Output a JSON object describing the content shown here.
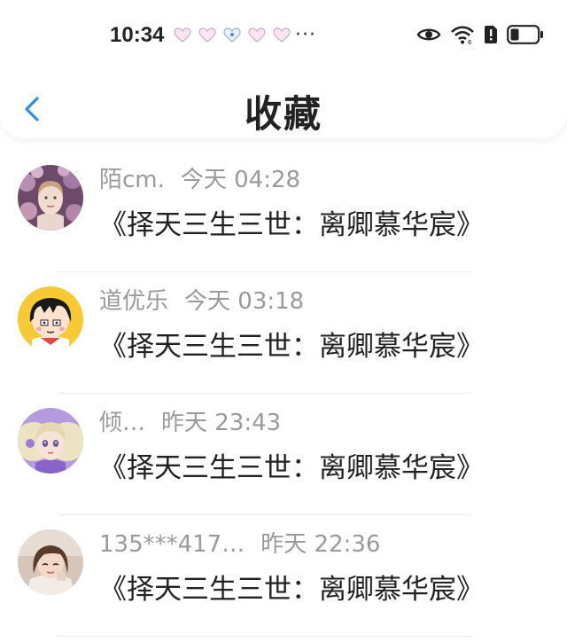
{
  "status_bar": {
    "time": "10:34",
    "more": "···",
    "notification_icons": [
      "heart-icon",
      "heart-icon",
      "heart-icon",
      "heart-icon",
      "heart-icon"
    ],
    "system_icons": [
      "eye-icon",
      "wifi-icon",
      "sim-alert-icon",
      "battery-icon"
    ]
  },
  "header": {
    "title": "收藏",
    "back_icon": "chevron-left-icon",
    "accent": "#2f8ee6"
  },
  "favorites": [
    {
      "name": "陌cm.",
      "time": "今天 04:28",
      "book": "《择天三生三世：离卿慕华宸》"
    },
    {
      "name": "道优乐",
      "time": "今天 03:18",
      "book": "《择天三生三世：离卿慕华宸》"
    },
    {
      "name": "倾…",
      "time": "昨天 23:43",
      "book": "《择天三生三世：离卿慕华宸》"
    },
    {
      "name": "135***417…",
      "time": "昨天 22:36",
      "book": "《择天三生三世：离卿慕华宸》"
    }
  ]
}
